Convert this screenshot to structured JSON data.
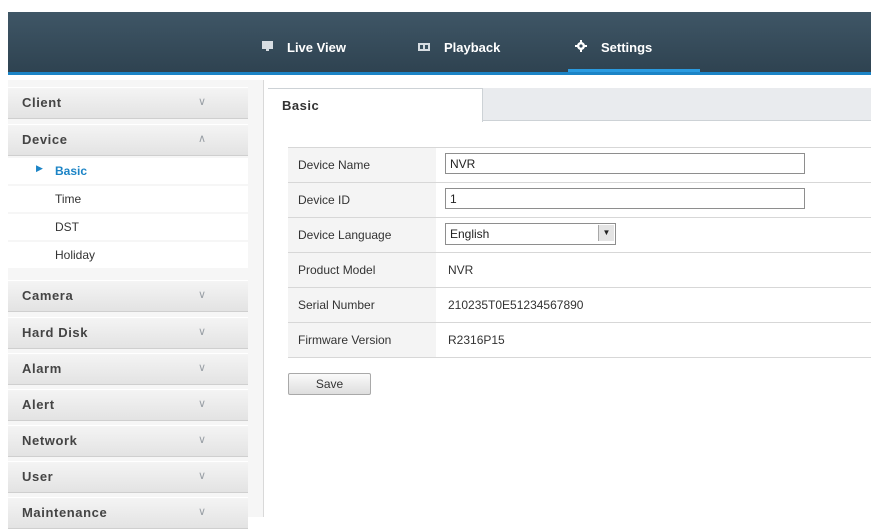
{
  "nav": {
    "live_view": {
      "label": "Live View",
      "icon": "monitor-icon"
    },
    "playback": {
      "label": "Playback",
      "icon": "film-icon"
    },
    "settings": {
      "label": "Settings",
      "icon": "gear-icon"
    },
    "active": "settings"
  },
  "sidebar": {
    "sections": [
      {
        "label": "Client",
        "expanded": false
      },
      {
        "label": "Device",
        "expanded": true
      },
      {
        "label": "Camera",
        "expanded": false
      },
      {
        "label": "Hard Disk",
        "expanded": false
      },
      {
        "label": "Alarm",
        "expanded": false
      },
      {
        "label": "Alert",
        "expanded": false
      },
      {
        "label": "Network",
        "expanded": false
      },
      {
        "label": "User",
        "expanded": false
      },
      {
        "label": "Maintenance",
        "expanded": false
      }
    ],
    "device_items": [
      {
        "label": "Basic",
        "active": true
      },
      {
        "label": "Time",
        "active": false
      },
      {
        "label": "DST",
        "active": false
      },
      {
        "label": "Holiday",
        "active": false
      }
    ],
    "collapsed_chevron": "∨",
    "expanded_chevron": "∧"
  },
  "main": {
    "tab_label": "Basic",
    "fields": {
      "device_name": {
        "label": "Device Name",
        "value": "NVR"
      },
      "device_id": {
        "label": "Device ID",
        "value": "1"
      },
      "device_language": {
        "label": "Device Language",
        "value": "English"
      },
      "product_model": {
        "label": "Product Model",
        "value": "NVR"
      },
      "serial_number": {
        "label": "Serial Number",
        "value": "210235T0E51234567890"
      },
      "firmware_version": {
        "label": "Firmware Version",
        "value": "R2316P15"
      }
    },
    "save_label": "Save"
  },
  "colors": {
    "header_bg": "#34495a",
    "accent": "#1c84c6",
    "sidebar_bg": "#f6f6f6"
  }
}
